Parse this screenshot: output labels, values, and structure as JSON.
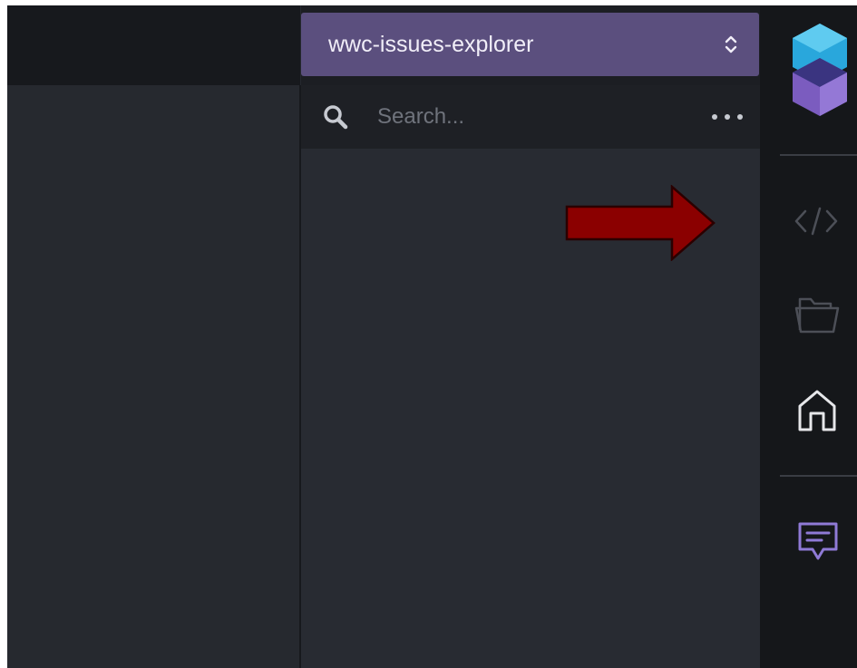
{
  "project_selector": {
    "label": "wwc-issues-explorer",
    "icon": "chevron-up-down-icon"
  },
  "search": {
    "placeholder": "Search...",
    "search_icon": "search-icon",
    "more_icon": "more-horizontal-icon"
  },
  "annotation": {
    "type": "arrow",
    "direction": "right",
    "color": "#8b0000"
  },
  "activity_bar": {
    "logo": "product-logo-icon",
    "items": [
      {
        "name": "code",
        "icon": "code-icon",
        "active": false
      },
      {
        "name": "files",
        "icon": "folder-icon",
        "active": false
      },
      {
        "name": "home",
        "icon": "home-icon",
        "active": true
      },
      {
        "name": "feedback",
        "icon": "feedback-icon",
        "active": false
      }
    ]
  },
  "colors": {
    "accent": "#5b4f7e",
    "feedback_icon": "#8f7ad6",
    "panel_bg": "#282b32",
    "activity_bg": "#15171a"
  }
}
